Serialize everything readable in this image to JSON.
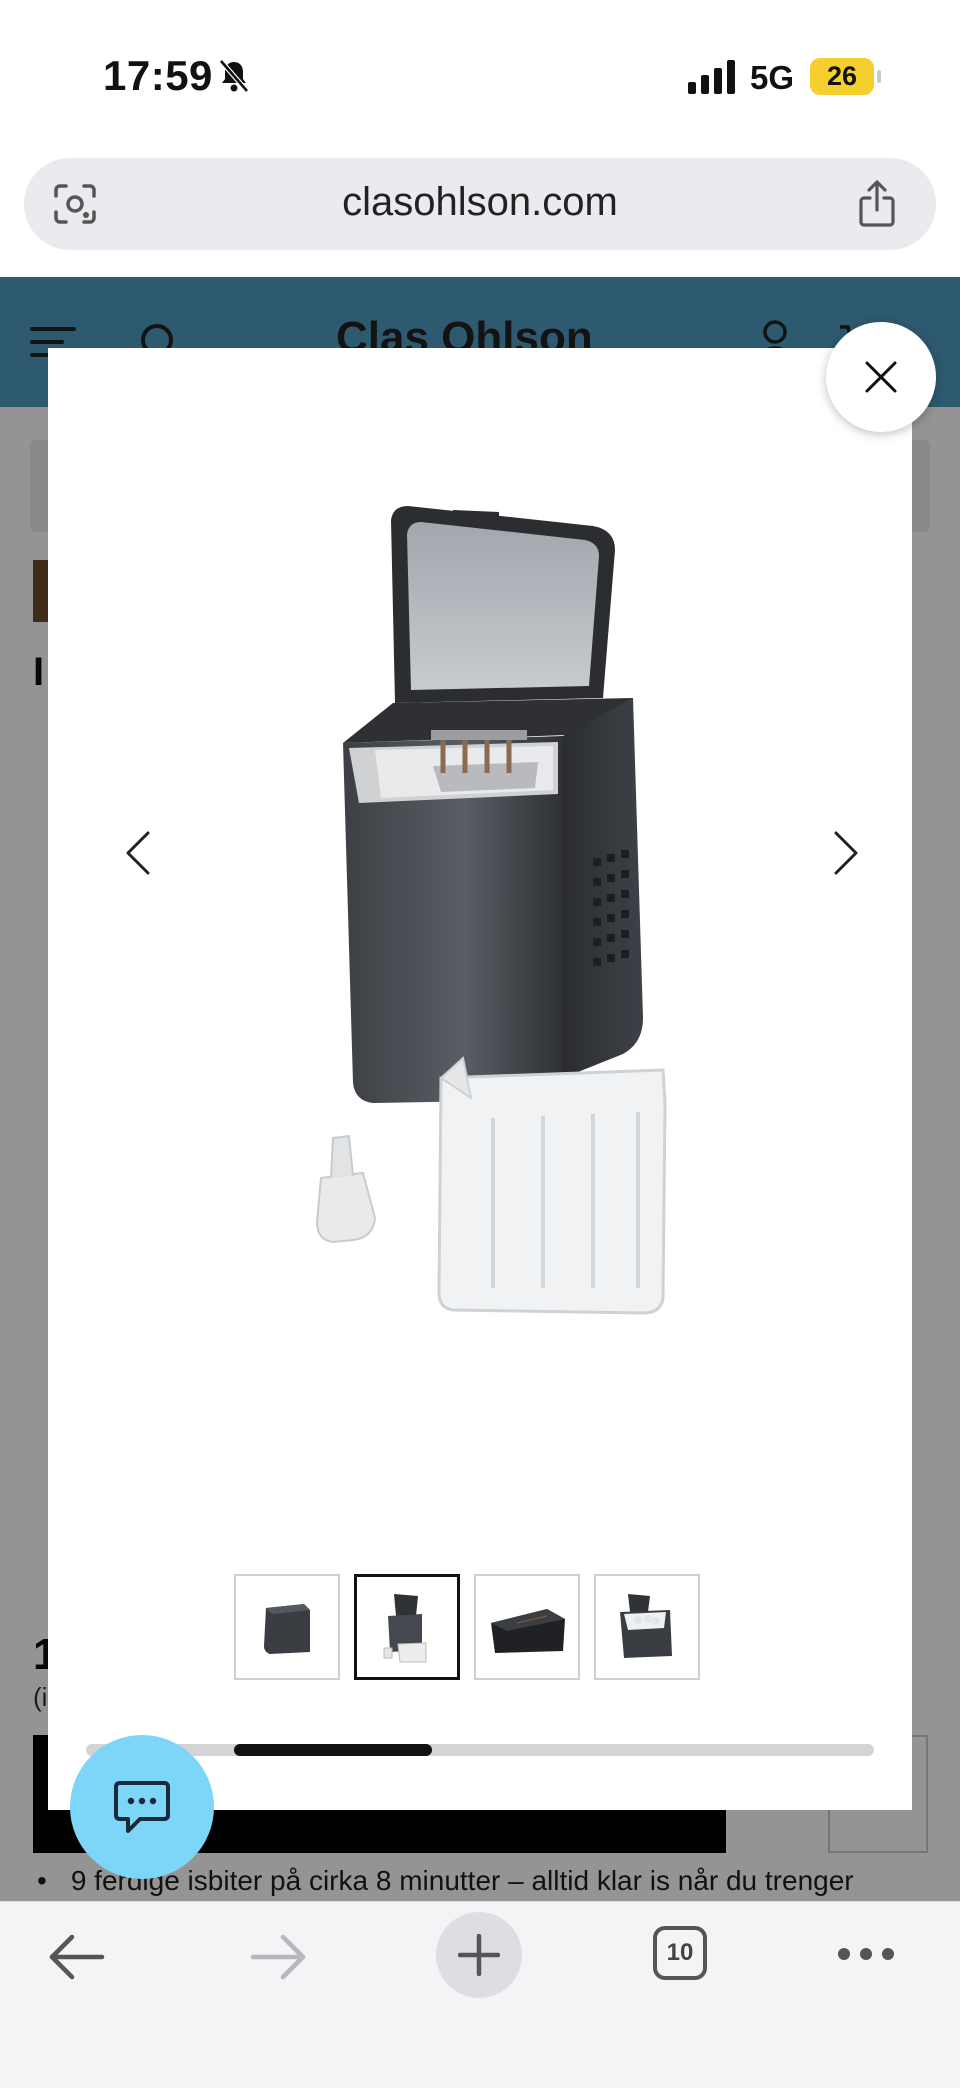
{
  "status_bar": {
    "time": "17:59",
    "network": "5G",
    "battery": "26"
  },
  "browser": {
    "url": "clasohlson.com",
    "tab_count": "10"
  },
  "site": {
    "logo": "Clas Ohlson",
    "title_fragment": "I",
    "price_fragment": "1",
    "vat_fragment": "(i",
    "buy_fragment": "",
    "feature_bullet": "9 ferdige isbiter på cirka 8 minutter – alltid klar is når du trenger"
  },
  "gallery": {
    "thumbnails": [
      {
        "name": "thumbnail-closed"
      },
      {
        "name": "thumbnail-open-with-basket"
      },
      {
        "name": "thumbnail-top-lid"
      },
      {
        "name": "thumbnail-with-ice"
      }
    ],
    "active_index": 1,
    "scroll_position_fraction": 0.25
  },
  "colors": {
    "header": "#4e9bbf",
    "chat_button": "#7dd6f7",
    "battery": "#f5cf2e"
  }
}
